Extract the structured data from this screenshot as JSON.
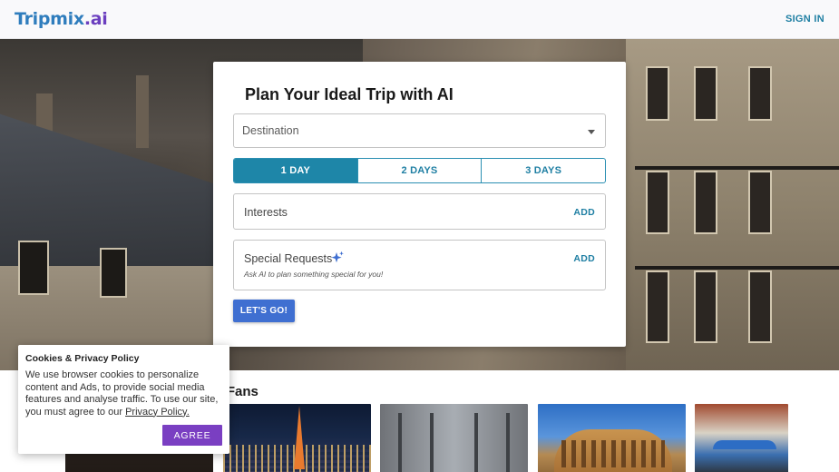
{
  "header": {
    "logo_part1": "Tripmix",
    "logo_part2": ".ai",
    "sign_in_label": "SIGN IN"
  },
  "planner": {
    "title": "Plan Your Ideal Trip with AI",
    "destination_placeholder": "Destination",
    "day_options": [
      "1 DAY",
      "2 DAYS",
      "3 DAYS"
    ],
    "selected_day_index": 0,
    "interests_label": "Interests",
    "interests_add_label": "ADD",
    "special_requests_label": "Special Requests",
    "special_requests_hint": "Ask AI to plan something special for you!",
    "special_requests_add_label": "ADD",
    "submit_label": "LET'S GO!"
  },
  "section": {
    "title_visible": "w Fans",
    "thumbnail_icons": [
      "restaurant-interior",
      "tokyo-skyline",
      "bridge-arches",
      "colosseum",
      "restaurant-street"
    ]
  },
  "cookie": {
    "title": "Cookies & Privacy Policy",
    "text": "We use browser cookies to personalize content and Ads, to provide social media features and analyse traffic. To use our site, you must agree to our",
    "link_label": "Privacy Policy.",
    "agree_label": "AGREE"
  },
  "colors": {
    "accent": "#1f7fa3",
    "active_day": "#1e86a8",
    "submit_button": "#3f6fd1",
    "agree_button": "#7a3fc2",
    "logo_blue": "#2f7dbd",
    "logo_purple": "#6b3fbf"
  }
}
